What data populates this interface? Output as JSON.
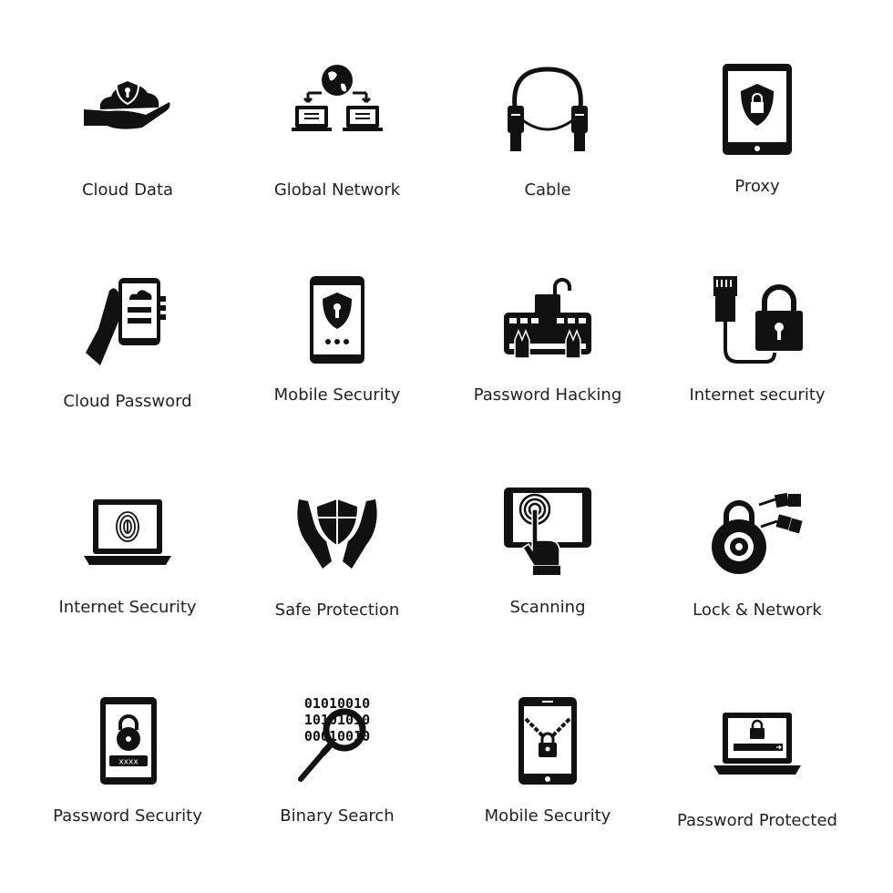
{
  "icons": [
    {
      "label": "Cloud Data",
      "icon": "cloud-shield-hand-icon"
    },
    {
      "label": "Global Network",
      "icon": "globe-laptops-icon"
    },
    {
      "label": "Cable",
      "icon": "cable-icon"
    },
    {
      "label": "Proxy",
      "icon": "tablet-shield-icon"
    },
    {
      "label": "Cloud Password",
      "icon": "hand-phone-login-icon"
    },
    {
      "label": "Mobile Security",
      "icon": "phone-shield-icon"
    },
    {
      "label": "Password Hacking",
      "icon": "keyboard-unlock-icon"
    },
    {
      "label": "Internet security",
      "icon": "ethernet-padlock-icon"
    },
    {
      "label": "Internet Security",
      "icon": "laptop-fingerprint-icon"
    },
    {
      "label": "Safe Protection",
      "icon": "hands-shield-icon"
    },
    {
      "label": "Scanning",
      "icon": "tablet-touch-icon"
    },
    {
      "label": "Lock & Network",
      "icon": "combination-lock-network-icon"
    },
    {
      "label": "Password Security",
      "icon": "phone-padlock-password-icon"
    },
    {
      "label": "Binary Search",
      "icon": "binary-magnifier-icon",
      "binary": [
        "01010010",
        "10101010",
        "00010010"
      ]
    },
    {
      "label": "Mobile Security",
      "icon": "phone-chain-lock-icon"
    },
    {
      "label": "Password Protected",
      "icon": "laptop-lock-password-icon"
    }
  ],
  "colors": {
    "icon": "#111111",
    "text": "#222222",
    "background": "#ffffff"
  }
}
